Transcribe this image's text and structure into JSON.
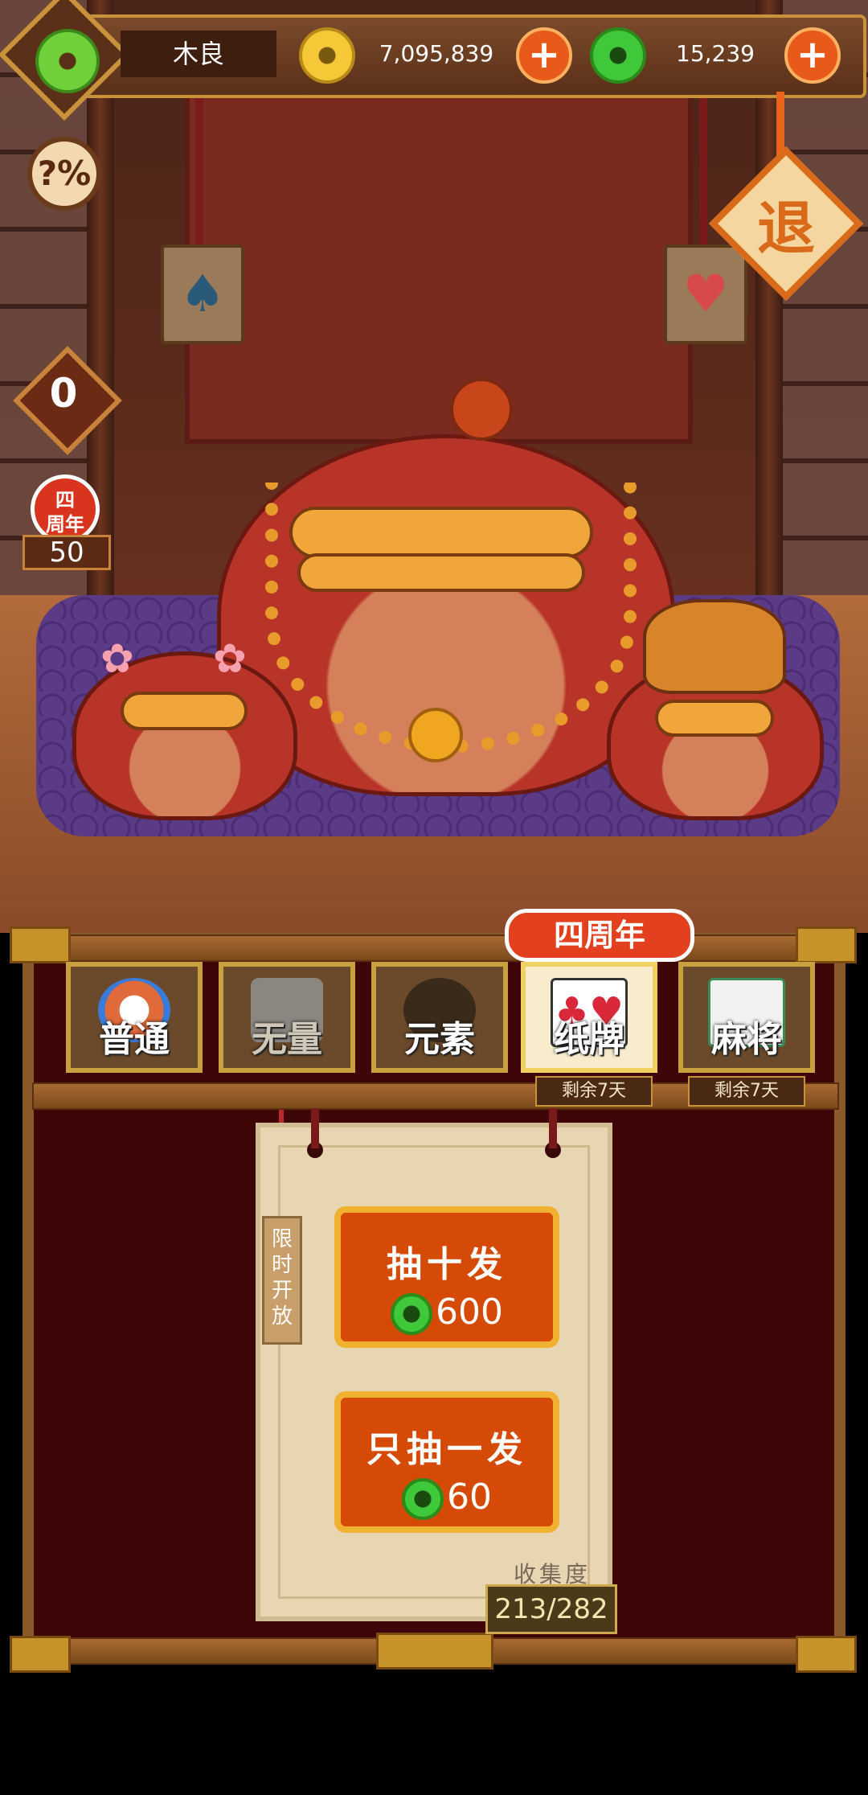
{
  "player": {
    "name": "木良",
    "avatar_icon": "jade-coin-icon"
  },
  "currency": {
    "gold": {
      "amount": "7,095,839",
      "icon": "gold-coin-icon"
    },
    "jade": {
      "amount": "15,239",
      "icon": "jade-coin-icon"
    },
    "add_label": "+"
  },
  "side": {
    "odds_label": "?%",
    "counter": "0",
    "anniversary_badge": "四周年",
    "anniversary_count": "50"
  },
  "exit_label": "退",
  "tabs": [
    {
      "label": "普通",
      "active": false,
      "days_left": ""
    },
    {
      "label": "无量",
      "active": false,
      "days_left": ""
    },
    {
      "label": "元素",
      "active": false,
      "days_left": ""
    },
    {
      "label": "纸牌",
      "active": true,
      "days_left": "剩余7天"
    },
    {
      "label": "麻将",
      "active": false,
      "days_left": "剩余7天"
    }
  ],
  "anniversary_tab_badge": "四周年",
  "gacha": {
    "limited_tag": "限时开放",
    "ten_draw": {
      "title": "抽十发",
      "cost": "600"
    },
    "single_draw": {
      "title": "只抽一发",
      "cost": "60"
    },
    "collection_label": "收集度",
    "collection_count": "213/282"
  },
  "colors": {
    "accent": "#d44a06",
    "gold": "#f5c838",
    "jade": "#3ec83a",
    "panel": "#3e0606"
  }
}
